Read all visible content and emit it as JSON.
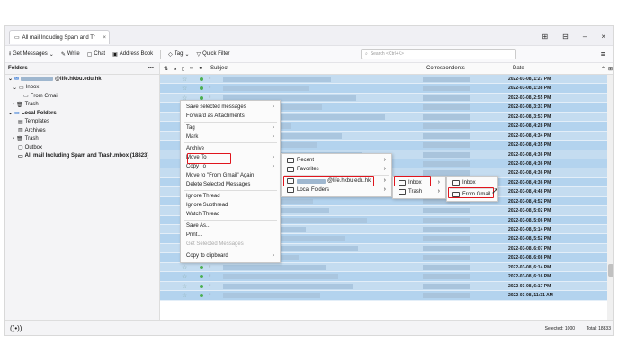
{
  "window": {
    "tab_title": "All mail Including Spam and Tr",
    "close_tab": "×",
    "controls": [
      "⊞",
      "⊟",
      "–",
      "×"
    ]
  },
  "toolbar": {
    "get_messages": "Get Messages",
    "write": "Write",
    "chat": "Chat",
    "address_book": "Address Book",
    "tag": "Tag",
    "quick_filter": "Quick Filter",
    "search_placeholder": "Search <Ctrl+K>",
    "menu_icon": "≡"
  },
  "folders": {
    "header": "Folders",
    "header_menu": "•••",
    "account": "@life.hkbu.edu.hk",
    "items": [
      {
        "label": "Inbox",
        "indent": 2
      },
      {
        "label": "From Gmail",
        "indent": 3
      },
      {
        "label": "Trash",
        "indent": 2
      },
      {
        "label": "Local Folders",
        "indent": 1
      },
      {
        "label": "Templates",
        "indent": 2
      },
      {
        "label": "Archives",
        "indent": 2
      },
      {
        "label": "Trash",
        "indent": 2
      },
      {
        "label": "Outbox",
        "indent": 2
      },
      {
        "label": "All mail Including Spam and Trash.mbox (18823)",
        "indent": 2
      }
    ]
  },
  "list": {
    "col_subject": "Subject",
    "col_correspondents": "Correspondents",
    "col_date": "Date",
    "dates": [
      "2022-03-08, 1:27 PM",
      "2022-03-08, 1:38 PM",
      "2022-03-08, 2:55 PM",
      "2022-03-08, 3:31 PM",
      "2022-03-08, 3:53 PM",
      "2022-03-08, 4:28 PM",
      "2022-03-08, 4:34 PM",
      "2022-03-08, 4:35 PM",
      "2022-03-08, 4:36 PM",
      "2022-03-08, 4:36 PM",
      "2022-03-08, 4:36 PM",
      "2022-03-08, 4:36 PM",
      "2022-03-08, 4:48 PM",
      "2022-03-08, 4:52 PM",
      "2022-03-08, 5:02 PM",
      "2022-03-08, 5:06 PM",
      "2022-03-08, 5:14 PM",
      "2022-03-08, 5:52 PM",
      "2022-03-08, 6:07 PM",
      "2022-03-08, 6:08 PM",
      "2022-03-08, 6:14 PM",
      "2022-03-08, 6:16 PM",
      "2022-03-08, 6:17 PM",
      "2022-03-08, 11:31 AM"
    ]
  },
  "context_menu": {
    "items": [
      "Save selected messages",
      "Forward as Attachments",
      "Tag",
      "Mark",
      "Archive",
      "Move To",
      "Copy To",
      "Move to \"From Gmail\" Again",
      "Delete Selected Messages",
      "Ignore Thread",
      "Ignore Subthread",
      "Watch Thread",
      "Save As...",
      "Print...",
      "Get Selected Messages",
      "Copy to clipboard"
    ]
  },
  "move_menu": {
    "items": [
      "Recent",
      "Favorites",
      "@life.hkbu.edu.hk",
      "Local Folders"
    ]
  },
  "account_menu": {
    "items": [
      "Inbox",
      "Trash"
    ]
  },
  "inbox_menu": {
    "items": [
      "Inbox",
      "From Gmail"
    ]
  },
  "status": {
    "left_icon": "((•))",
    "selected": "Selected: 1000",
    "total": "Total: 18833"
  },
  "colors": {
    "row_bg": "#c4dcf0",
    "highlight": "#e0151d"
  }
}
